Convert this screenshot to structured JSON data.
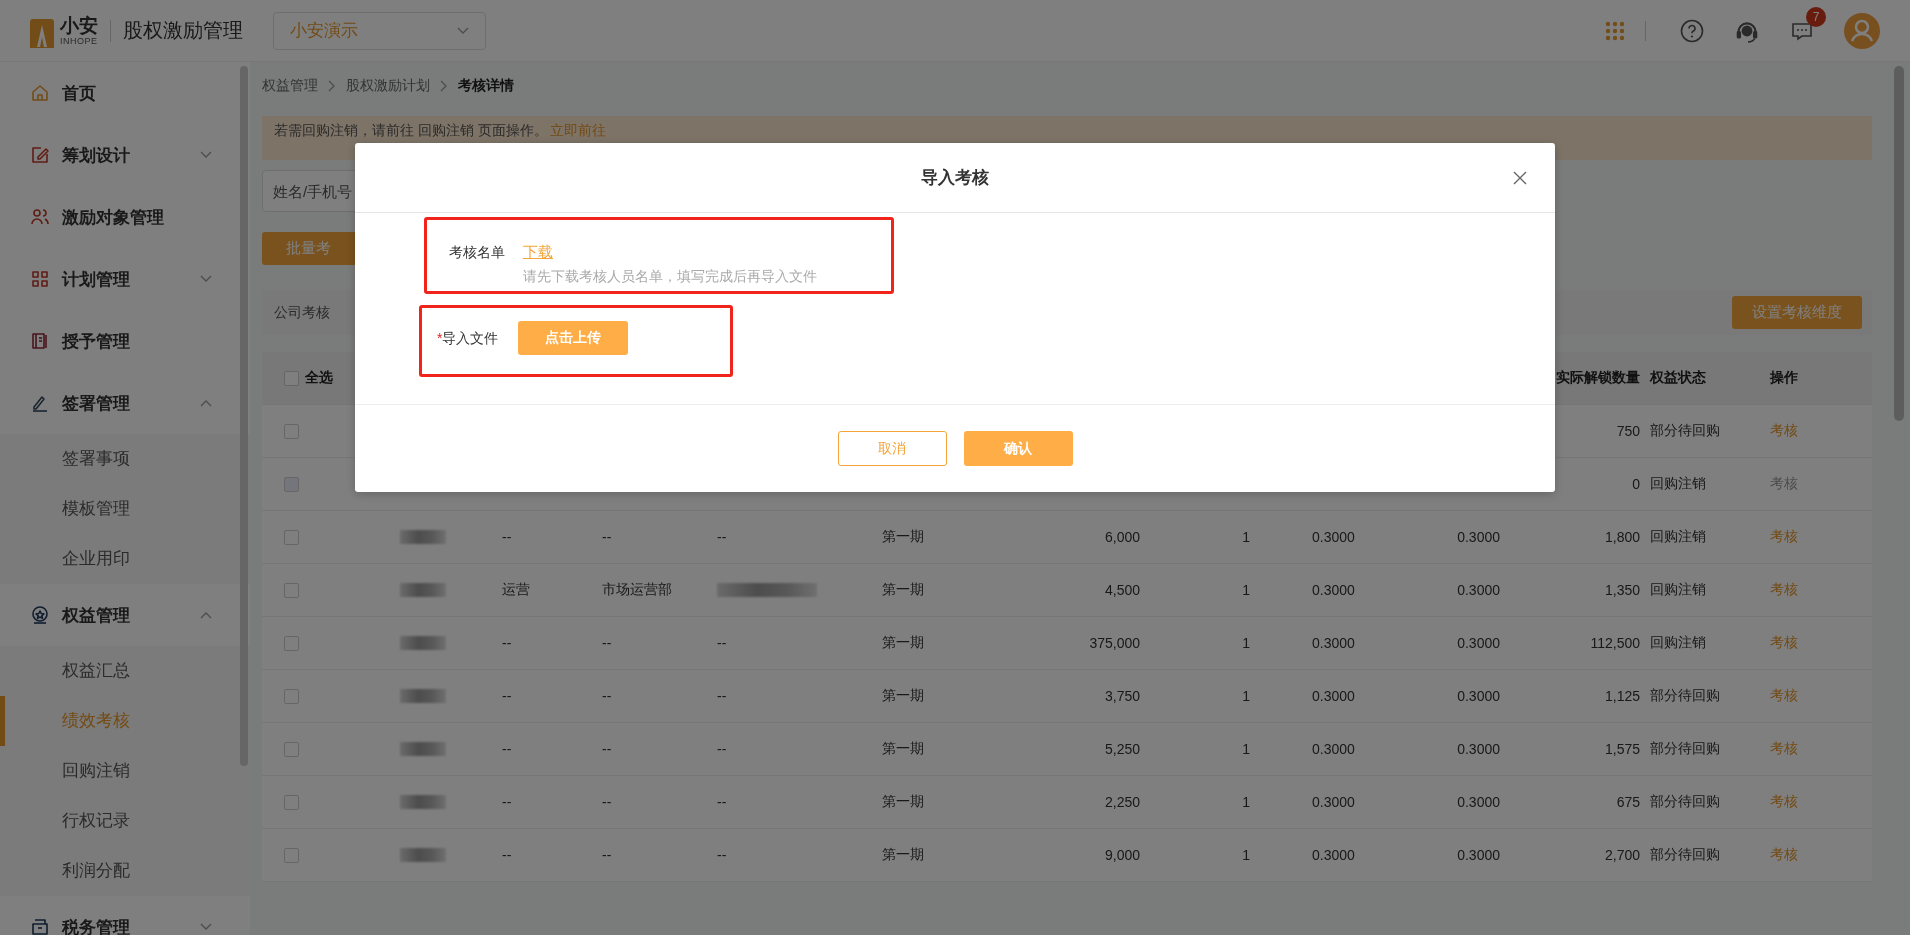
{
  "header": {
    "logo_text": "小安",
    "logo_subtext": "INHOPE",
    "app_title": "股权激励管理",
    "company_select": "小安演示",
    "notification_count": "7"
  },
  "sidebar": {
    "items": [
      {
        "label": "首页",
        "selected": false
      },
      {
        "label": "筹划设计",
        "selected": false,
        "expanded": false
      },
      {
        "label": "激励对象管理",
        "selected": false
      },
      {
        "label": "计划管理",
        "selected": false,
        "expanded": false
      },
      {
        "label": "授予管理",
        "selected": false
      },
      {
        "label": "签署管理",
        "selected": false,
        "expanded": true,
        "children": [
          {
            "label": "签署事项",
            "selected": false
          },
          {
            "label": "模板管理",
            "selected": false
          },
          {
            "label": "企业用印",
            "selected": false
          }
        ]
      },
      {
        "label": "权益管理",
        "selected": false,
        "expanded": true,
        "children": [
          {
            "label": "权益汇总",
            "selected": false
          },
          {
            "label": "绩效考核",
            "selected": true
          },
          {
            "label": "回购注销",
            "selected": false
          },
          {
            "label": "行权记录",
            "selected": false
          },
          {
            "label": "利润分配",
            "selected": false
          }
        ]
      },
      {
        "label": "税务管理",
        "selected": false,
        "expanded": false
      }
    ]
  },
  "breadcrumb": [
    "权益管理",
    "股权激励计划",
    "考核详情"
  ],
  "notice": {
    "text": "若需回购注销，请前往 回购注销 页面操作。",
    "link": "立即前往"
  },
  "search": {
    "placeholder": "姓名/手机号"
  },
  "batch_button": "批量考",
  "section": {
    "title": "公司考核",
    "button": "设置考核维度"
  },
  "table": {
    "select_all": {
      "label": "全选",
      "checked": false
    },
    "columns": [
      "",
      "",
      "",
      "",
      "",
      "",
      "",
      "",
      "实际解锁数量",
      "权益状态",
      "操作"
    ],
    "rows": [
      {
        "checked": false,
        "disabled": false,
        "cells": [
          null,
          null,
          null,
          null,
          null,
          null,
          null,
          null,
          "750",
          "部分待回购",
          "考核"
        ]
      },
      {
        "checked": false,
        "disabled": true,
        "cells": [
          null,
          null,
          null,
          null,
          null,
          null,
          null,
          null,
          "0",
          "回购注销",
          "考核"
        ]
      },
      {
        "checked": false,
        "disabled": false,
        "cells": [
          "--",
          "--",
          "--",
          "第一期",
          "6,000",
          "1",
          "0.3000",
          "0.3000",
          "1,800",
          "回购注销",
          "考核"
        ]
      },
      {
        "checked": false,
        "disabled": false,
        "cells": [
          "运营",
          "市场运营部",
          {
            "kind": "redacted"
          },
          "第一期",
          "4,500",
          "1",
          "0.3000",
          "0.3000",
          "1,350",
          "回购注销",
          "考核"
        ]
      },
      {
        "checked": false,
        "disabled": false,
        "cells": [
          "--",
          "--",
          "--",
          "第一期",
          "375,000",
          "1",
          "0.3000",
          "0.3000",
          "112,500",
          "回购注销",
          "考核"
        ]
      },
      {
        "checked": false,
        "disabled": false,
        "cells": [
          "--",
          "--",
          "--",
          "第一期",
          "3,750",
          "1",
          "0.3000",
          "0.3000",
          "1,125",
          "部分待回购",
          "考核"
        ]
      },
      {
        "checked": false,
        "disabled": false,
        "cells": [
          "--",
          "--",
          "--",
          "第一期",
          "5,250",
          "1",
          "0.3000",
          "0.3000",
          "1,575",
          "部分待回购",
          "考核"
        ]
      },
      {
        "checked": false,
        "disabled": false,
        "cells": [
          "--",
          "--",
          "--",
          "第一期",
          "2,250",
          "1",
          "0.3000",
          "0.3000",
          "675",
          "部分待回购",
          "考核"
        ]
      },
      {
        "checked": false,
        "disabled": false,
        "cells": [
          "--",
          "--",
          "--",
          "第一期",
          "9,000",
          "1",
          "0.3000",
          "0.3000",
          "2,700",
          "部分待回购",
          "考核"
        ]
      }
    ]
  },
  "dialog": {
    "title": "导入考核",
    "template_label": "考核名单",
    "download_link": "下载",
    "template_hint": "请先下载考核人员名单，填写完成后再导入文件",
    "required_mark": "*",
    "file_label": "导入文件",
    "upload_button": "点击上传",
    "cancel_button": "取消",
    "confirm_button": "确认"
  }
}
